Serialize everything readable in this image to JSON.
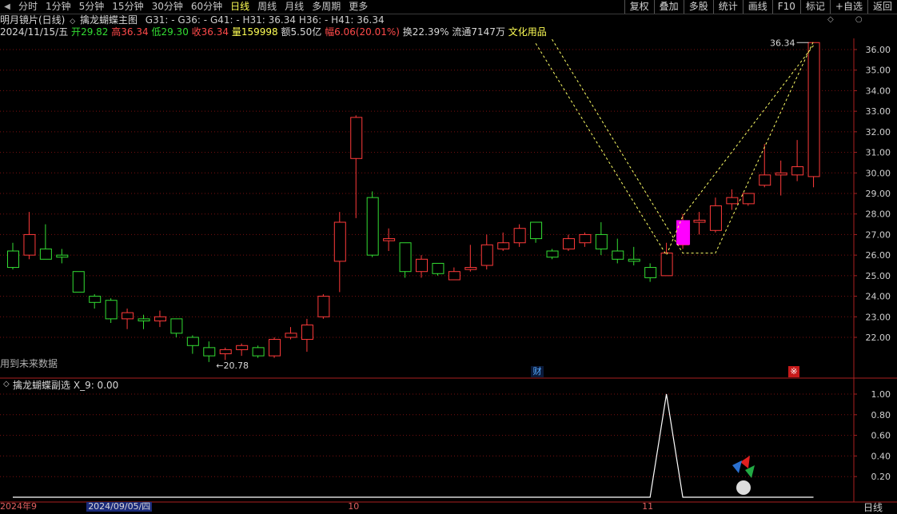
{
  "nav": {
    "tabs": [
      "分时",
      "1分钟",
      "5分钟",
      "15分钟",
      "30分钟",
      "60分钟",
      "日线",
      "周线",
      "月线",
      "多周期",
      "更多"
    ],
    "active_tab": "日线",
    "right_buttons": [
      "复权",
      "叠加",
      "多股",
      "统计",
      "画线",
      "F10",
      "标记",
      "+自选",
      "返回"
    ]
  },
  "header": {
    "stock_name": "明月镜片(日线)",
    "indicator_name": "擒龙蝴蝶主图",
    "values": "G31: -  G36: -  G41: -  H31: 36.34  H36: -  H41: 36.34",
    "date": "2024/11/15/五",
    "open_label": "开",
    "open": "29.82",
    "high_label": "高",
    "high": "36.34",
    "low_label": "低",
    "low": "29.30",
    "close_label": "收",
    "close": "36.34",
    "vol_label": "量",
    "vol": "159998",
    "amt_label": "额",
    "amt": "5.50亿",
    "chg_label": "幅",
    "chg": "6.06(20.01%)",
    "turn_label": "换",
    "turn": "22.39%",
    "float_label": "流通",
    "float": "7147万",
    "sector": "文化用品"
  },
  "labels": {
    "future_data": "用到未来数据",
    "low_marker": "←20.78",
    "high_marker": "36.34",
    "badge_finance": "财",
    "badge_event": "※",
    "sub_indicator": "擒龙蝴蝶副选",
    "sub_value": "X_9: 0.00",
    "period_label": "日线"
  },
  "date_axis": {
    "labels": [
      {
        "text": "2024年9",
        "i": 0
      },
      {
        "text": "2024/09/05/四",
        "i": 5
      },
      {
        "text": "10",
        "i": 21
      },
      {
        "text": "11",
        "i": 39
      }
    ]
  },
  "colors": {
    "up": "#ff3a3a",
    "down": "#33dd33",
    "grid": "#7a1010",
    "dashed": "#ffff66",
    "highlight": "#ff00ff",
    "axis_text": "#d0d0d0"
  },
  "chart_data": {
    "type": "candlestick",
    "y_axis_main": {
      "ticks": [
        22.0,
        23.0,
        24.0,
        25.0,
        26.0,
        27.0,
        28.0,
        29.0,
        30.0,
        31.0,
        32.0,
        33.0,
        34.0,
        35.0,
        36.0
      ]
    },
    "y_axis_sub": {
      "ticks": [
        0.2,
        0.4,
        0.6,
        0.8,
        1.0
      ]
    },
    "candles": [
      {
        "o": 26.2,
        "h": 26.6,
        "l": 25.3,
        "c": 25.4
      },
      {
        "o": 26.0,
        "h": 28.1,
        "l": 25.8,
        "c": 27.0
      },
      {
        "o": 26.3,
        "h": 27.5,
        "l": 25.8,
        "c": 25.8
      },
      {
        "o": 26.0,
        "h": 26.3,
        "l": 25.6,
        "c": 25.9
      },
      {
        "o": 25.2,
        "h": 25.2,
        "l": 24.2,
        "c": 24.2
      },
      {
        "o": 24.0,
        "h": 24.1,
        "l": 23.4,
        "c": 23.7
      },
      {
        "o": 23.8,
        "h": 23.9,
        "l": 22.7,
        "c": 22.9
      },
      {
        "o": 22.9,
        "h": 23.4,
        "l": 22.4,
        "c": 23.2
      },
      {
        "o": 22.9,
        "h": 23.1,
        "l": 22.4,
        "c": 22.8
      },
      {
        "o": 22.8,
        "h": 23.3,
        "l": 22.5,
        "c": 23.0
      },
      {
        "o": 22.9,
        "h": 22.9,
        "l": 22.0,
        "c": 22.2
      },
      {
        "o": 22.0,
        "h": 22.1,
        "l": 21.2,
        "c": 21.6
      },
      {
        "o": 21.5,
        "h": 21.8,
        "l": 20.8,
        "c": 21.1
      },
      {
        "o": 21.2,
        "h": 21.5,
        "l": 20.9,
        "c": 21.4
      },
      {
        "o": 21.4,
        "h": 21.7,
        "l": 21.1,
        "c": 21.6
      },
      {
        "o": 21.5,
        "h": 21.6,
        "l": 21.0,
        "c": 21.1
      },
      {
        "o": 21.1,
        "h": 22.0,
        "l": 21.0,
        "c": 21.9
      },
      {
        "o": 22.0,
        "h": 22.5,
        "l": 21.9,
        "c": 22.2
      },
      {
        "o": 21.9,
        "h": 22.9,
        "l": 21.3,
        "c": 22.6
      },
      {
        "o": 23.0,
        "h": 24.1,
        "l": 22.9,
        "c": 24.0
      },
      {
        "o": 25.7,
        "h": 28.1,
        "l": 24.2,
        "c": 27.6
      },
      {
        "o": 30.7,
        "h": 32.8,
        "l": 27.8,
        "c": 32.7
      },
      {
        "o": 28.8,
        "h": 29.1,
        "l": 25.9,
        "c": 26.0
      },
      {
        "o": 26.7,
        "h": 27.3,
        "l": 26.2,
        "c": 26.8
      },
      {
        "o": 26.6,
        "h": 26.6,
        "l": 24.9,
        "c": 25.2
      },
      {
        "o": 25.2,
        "h": 26.0,
        "l": 24.9,
        "c": 25.8
      },
      {
        "o": 25.6,
        "h": 25.6,
        "l": 25.0,
        "c": 25.1
      },
      {
        "o": 24.8,
        "h": 25.4,
        "l": 24.8,
        "c": 25.2
      },
      {
        "o": 25.3,
        "h": 26.5,
        "l": 25.2,
        "c": 25.4
      },
      {
        "o": 25.5,
        "h": 27.0,
        "l": 25.3,
        "c": 26.5
      },
      {
        "o": 26.3,
        "h": 27.1,
        "l": 26.2,
        "c": 26.6
      },
      {
        "o": 26.6,
        "h": 27.5,
        "l": 26.4,
        "c": 27.3
      },
      {
        "o": 27.6,
        "h": 27.6,
        "l": 26.6,
        "c": 26.8
      },
      {
        "o": 26.2,
        "h": 26.3,
        "l": 25.8,
        "c": 25.9
      },
      {
        "o": 26.3,
        "h": 27.0,
        "l": 26.2,
        "c": 26.8
      },
      {
        "o": 26.6,
        "h": 27.1,
        "l": 26.4,
        "c": 27.0
      },
      {
        "o": 27.0,
        "h": 27.6,
        "l": 26.0,
        "c": 26.3
      },
      {
        "o": 26.2,
        "h": 26.8,
        "l": 25.6,
        "c": 25.8
      },
      {
        "o": 25.8,
        "h": 26.4,
        "l": 25.5,
        "c": 25.7
      },
      {
        "o": 25.4,
        "h": 25.6,
        "l": 24.7,
        "c": 24.9
      },
      {
        "o": 25.0,
        "h": 26.6,
        "l": 25.0,
        "c": 26.1
      },
      {
        "o": 26.5,
        "h": 28.0,
        "l": 26.3,
        "c": 27.6
      },
      {
        "o": 27.6,
        "h": 28.1,
        "l": 27.0,
        "c": 27.7
      },
      {
        "o": 27.2,
        "h": 28.8,
        "l": 27.1,
        "c": 28.4
      },
      {
        "o": 28.5,
        "h": 29.2,
        "l": 28.2,
        "c": 28.8
      },
      {
        "o": 28.5,
        "h": 29.0,
        "l": 28.4,
        "c": 29.0
      },
      {
        "o": 29.4,
        "h": 31.4,
        "l": 29.3,
        "c": 29.9
      },
      {
        "o": 29.9,
        "h": 30.6,
        "l": 28.9,
        "c": 30.0
      },
      {
        "o": 29.9,
        "h": 31.6,
        "l": 29.6,
        "c": 30.3
      },
      {
        "o": 29.82,
        "h": 36.34,
        "l": 29.3,
        "c": 36.34
      }
    ],
    "highlight_box": {
      "i": 41,
      "top": 27.7,
      "bottom": 26.5
    },
    "butterfly_path": [
      {
        "i": 33,
        "y": 36.5
      },
      {
        "i": 41,
        "y": 26.1
      },
      {
        "i": 43,
        "y": 26.1
      },
      {
        "i": 49,
        "y": 36.4
      }
    ],
    "butterfly_path2": [
      {
        "i": 32,
        "y": 36.3
      },
      {
        "i": 40,
        "y": 26.0
      },
      {
        "i": 41,
        "y": 27.9
      },
      {
        "i": 49,
        "y": 36.2
      }
    ],
    "sub_series": [
      {
        "i": 0,
        "v": 0
      },
      {
        "i": 39,
        "v": 0
      },
      {
        "i": 40,
        "v": 1.0
      },
      {
        "i": 41,
        "v": 0
      },
      {
        "i": 49,
        "v": 0
      }
    ]
  }
}
